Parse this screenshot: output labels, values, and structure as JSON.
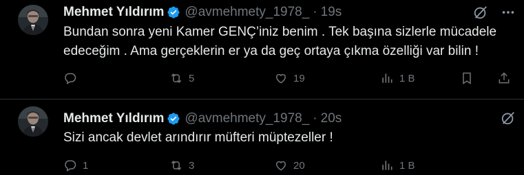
{
  "colors": {
    "background": "#000000",
    "text": "#e7e9ea",
    "muted": "#71767b",
    "verified": "#1d9bf0",
    "divider": "#2f3336"
  },
  "tweets": [
    {
      "author_name": "Mehmet Yıldırım",
      "handle": "@avmehmety_1978_",
      "separator": "·",
      "time": "19s",
      "text": "Bundan sonra yeni Kamer GENÇ’iniz benim . Tek başına sizlerle mücadele edeceğim . Ama gerçeklerin er ya da geç ortaya çıkma özelliği var bilin !",
      "retweets": "5",
      "likes": "19",
      "views": "1 B",
      "icons": [
        "grok-icon",
        "more-icon",
        "reply-icon",
        "retweet-icon",
        "heart-icon",
        "views-icon",
        "bookmark-icon",
        "share-icon"
      ]
    },
    {
      "author_name": "Mehmet Yıldırım",
      "handle": "@avmehmety_1978_",
      "separator": "·",
      "time": "20s",
      "text": "Sizi ancak devlet arındırır müfteri müptezeller !",
      "replies": "1",
      "retweets": "3",
      "likes": "20",
      "views": "1 B",
      "icons": [
        "grok-icon",
        "reply-icon",
        "retweet-icon",
        "heart-icon",
        "views-icon"
      ]
    }
  ]
}
